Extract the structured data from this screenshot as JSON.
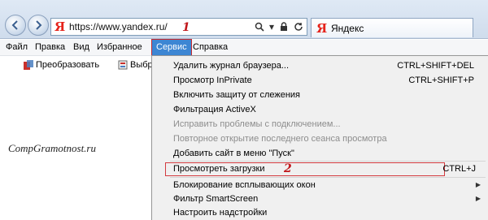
{
  "browser": {
    "address_url": "https://www.yandex.ru/",
    "tab_title": "Яндекс",
    "yandex_logo_letter": "Я",
    "marker_1": "1",
    "icons": [
      "back-icon",
      "forward-icon",
      "search-icon",
      "lock-icon",
      "refresh-icon"
    ]
  },
  "menubar": {
    "items": [
      {
        "label": "Файл"
      },
      {
        "label": "Правка"
      },
      {
        "label": "Вид"
      },
      {
        "label": "Избранное"
      },
      {
        "label": "Сервис"
      },
      {
        "label": "Справка"
      }
    ],
    "active": "Сервис"
  },
  "toolbar": {
    "convert_label": "Преобразовать",
    "select_label": "Выбр"
  },
  "watermark": "CompGramotnost.ru",
  "service_menu": {
    "items": [
      {
        "label": "Удалить журнал браузера...",
        "shortcut": "CTRL+SHIFT+DEL"
      },
      {
        "label": "Просмотр InPrivate",
        "shortcut": "CTRL+SHIFT+P"
      },
      {
        "label": "Включить защиту от слежения",
        "shortcut": ""
      },
      {
        "label": "Фильтрация ActiveX",
        "shortcut": ""
      },
      {
        "label": "Исправить проблемы с подключением...",
        "shortcut": "",
        "disabled": true
      },
      {
        "label": "Повторное открытие последнего сеанса просмотра",
        "shortcut": "",
        "disabled": true
      },
      {
        "label": "Добавить сайт в меню \"Пуск\"",
        "shortcut": ""
      },
      {
        "label": "Просмотреть загрузки",
        "shortcut": "CTRL+J",
        "highlighted": true,
        "marker": "2"
      },
      {
        "label": "Блокирование всплывающих окон",
        "shortcut": "",
        "submenu": true
      },
      {
        "label": "Фильтр SmartScreen",
        "shortcut": "",
        "submenu": true
      },
      {
        "label": "Настроить надстройки",
        "shortcut": ""
      }
    ]
  },
  "colors": {
    "menu_active_bg": "#3d86d3",
    "annotation_red": "#c0161a",
    "yandex_red": "#e5231b"
  }
}
